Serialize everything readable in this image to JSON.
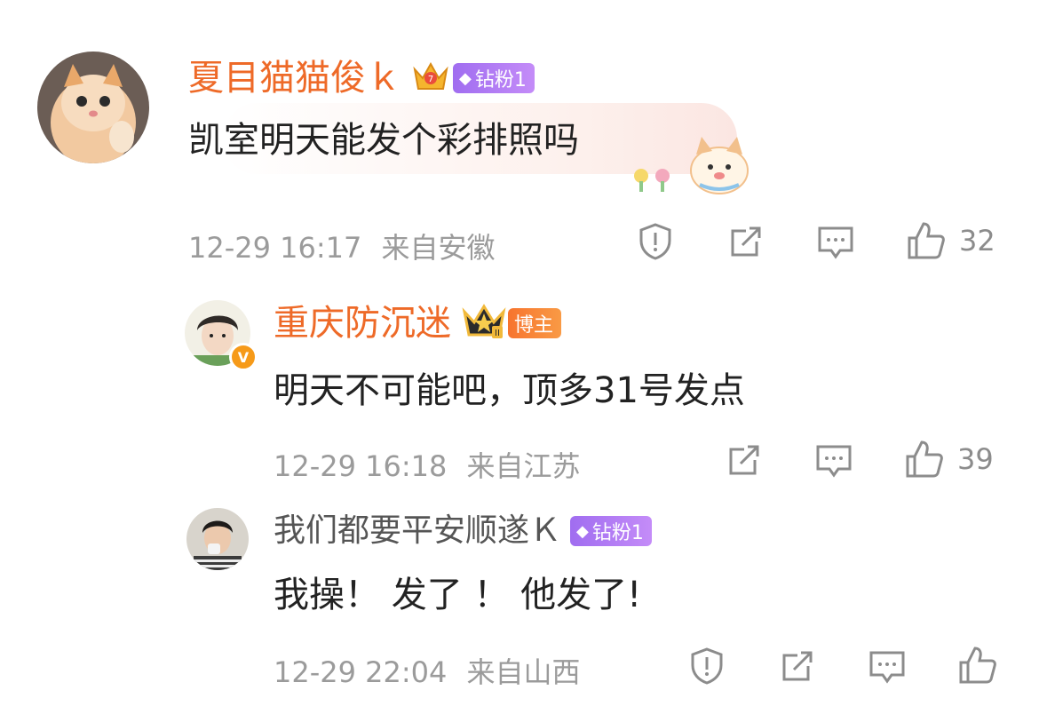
{
  "comments": [
    {
      "username": "夏目猫猫俊ｋ",
      "badge": "钻粉1",
      "text": "凯室明天能发个彩排照吗",
      "date": "12-29 16:17",
      "location": "来自安徽",
      "likes": "32"
    },
    {
      "username": "重庆防沉迷",
      "badge": "博主",
      "text": "明天不可能吧，顶多31号发点",
      "date": "12-29 16:18",
      "location": "来自江苏",
      "likes": "39"
    },
    {
      "username": "我们都要平安顺遂Ｋ",
      "badge": "钻粉1",
      "text": "我操！ 发了 ！ 他发了!",
      "date": "12-29 22:04",
      "location": "来自山西",
      "likes": ""
    }
  ],
  "icons": {
    "report": "warning-shield-icon",
    "share": "share-icon",
    "comment": "comment-icon",
    "like": "thumbs-up-icon"
  },
  "colors": {
    "username_accent": "#ee6a28",
    "badge_purple": "#a06df0",
    "badge_orange": "#f7742e",
    "meta_gray": "#9b9b9b"
  }
}
